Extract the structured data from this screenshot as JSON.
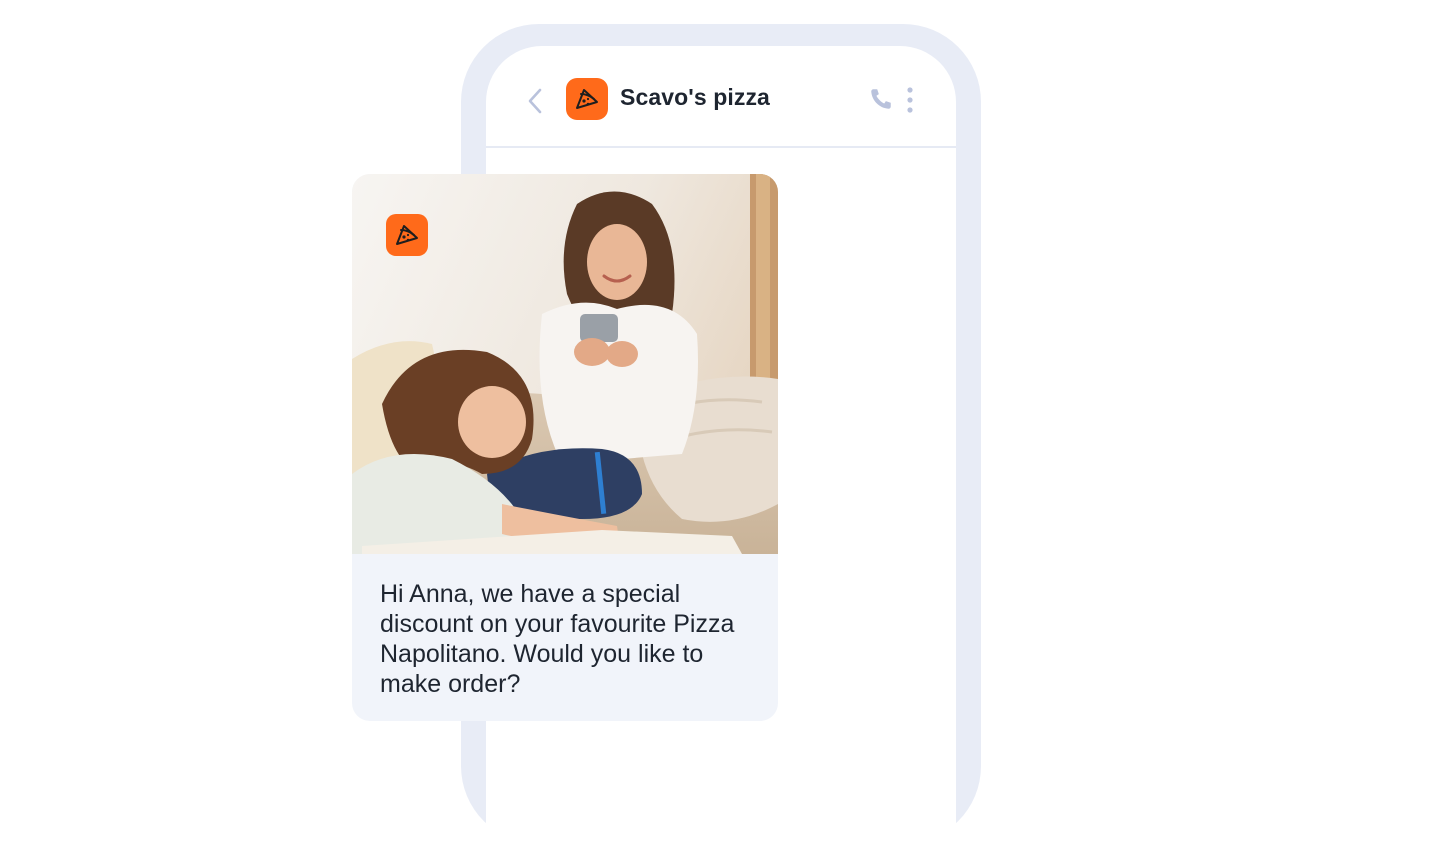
{
  "chat": {
    "title": "Scavo's pizza"
  },
  "header_icons": {
    "back": "chevron-left-icon",
    "brand": "pizza-slice-icon",
    "call": "phone-icon",
    "menu": "more-vertical-icon"
  },
  "message": {
    "text": "Hi Anna, we have a special discount on your favourite Pizza Napolitano. Would you like to make order?",
    "image": "photo of a smiling woman holding a smartphone next to a young girl drawing on paper, sitting on a beige sofa",
    "logo_icon": "pizza-slice-icon"
  },
  "colors": {
    "brand": "#ff6a1a",
    "frame": "#e8ecf6",
    "bubble": "#f1f4fa",
    "text": "#1e2530",
    "icon_muted": "#b9c2dc"
  }
}
